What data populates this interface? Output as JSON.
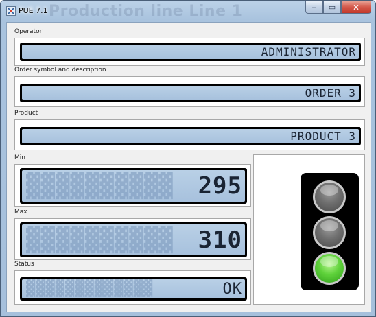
{
  "window": {
    "title": "PUE 7.1",
    "ghost_title": "Production line Line 1",
    "controls": {
      "minimize": "‒",
      "maximize": "▭",
      "close": "✕"
    }
  },
  "operator": {
    "label": "Operator",
    "value": "ADMINISTRATOR"
  },
  "order": {
    "label": "Order symbol and description",
    "value": "ORDER 3"
  },
  "product": {
    "label": "Product",
    "value": "PRODUCT 3"
  },
  "min": {
    "label": "Min",
    "value": "295"
  },
  "max": {
    "label": "Max",
    "value": "310"
  },
  "status": {
    "label": "Status",
    "value": "OK"
  },
  "traffic_light": {
    "lamps": [
      {
        "name": "red",
        "state": "off"
      },
      {
        "name": "yellow",
        "state": "off"
      },
      {
        "name": "green",
        "state": "on"
      }
    ],
    "colors": {
      "active": "#5fd23b",
      "inactive": "#6f6f6f"
    }
  },
  "icons": [
    "app-icon",
    "minimize-icon",
    "maximize-icon",
    "close-icon"
  ],
  "colors": {
    "lcd_background": "#b0c8e2",
    "lcd_text": "#1a2433",
    "frame": "#a6c0dc"
  }
}
